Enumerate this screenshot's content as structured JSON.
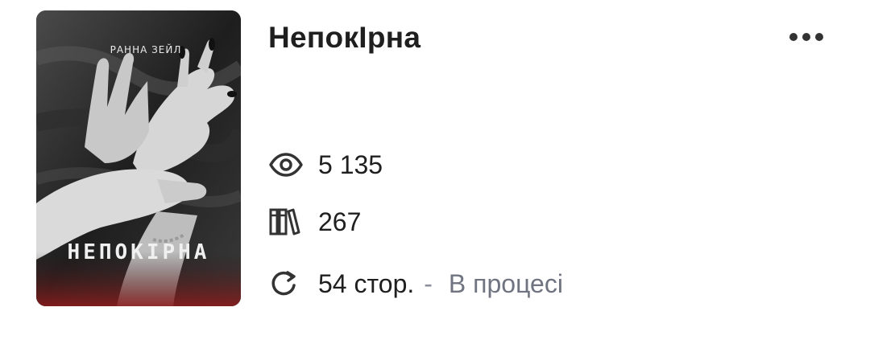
{
  "book": {
    "title": "НепокІрна",
    "cover": {
      "author_text": "РАННА ЗЕЙЛ",
      "title_text": "НЕПОКІРНА"
    }
  },
  "menu": {
    "icon": "more-horizontal-icon"
  },
  "stats": {
    "views": {
      "icon": "eye-icon",
      "value": "5 135"
    },
    "library": {
      "icon": "books-icon",
      "value": "267"
    },
    "pages": {
      "icon": "refresh-icon",
      "value": "54 стор.",
      "separator": "-",
      "status": "В процесі"
    }
  },
  "colors": {
    "text": "#1f1f1f",
    "muted": "#6f7480",
    "icon": "#333333"
  }
}
